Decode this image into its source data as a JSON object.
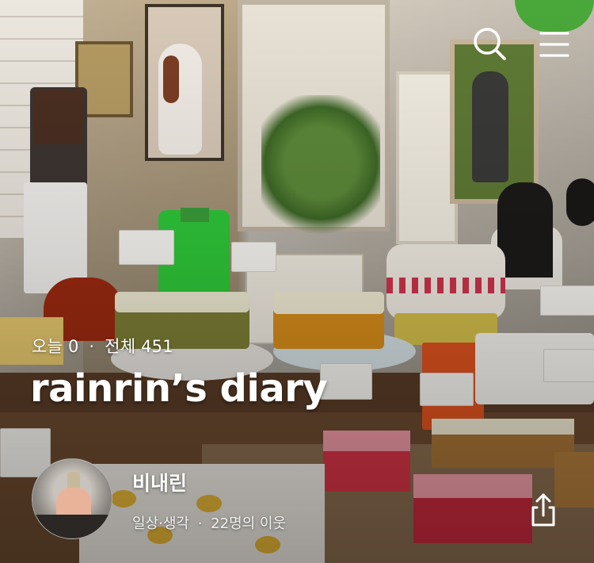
{
  "header": {
    "search_icon": "search-icon",
    "menu_icon": "hamburger-menu-icon"
  },
  "profile": {
    "today_label": "오늘",
    "today_count": "0",
    "separator": "·",
    "total_label": "전체",
    "total_count": "451",
    "blog_title": "rainrin’s diary",
    "nickname": "비내린",
    "category": "일상·생각",
    "meta_separator": "·",
    "neighbors": "22명의 이웃",
    "share_icon": "share-icon"
  },
  "colors": {
    "text": "#ffffff",
    "lamp_green": "#4aa83a",
    "jug_green": "#2fc93a"
  }
}
